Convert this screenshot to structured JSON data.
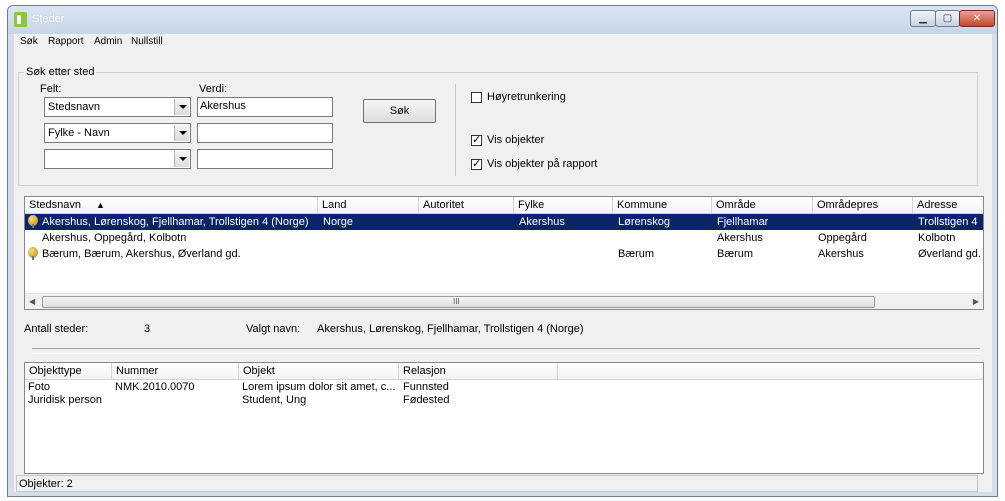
{
  "window": {
    "title": "Steder"
  },
  "menu": [
    "Søk",
    "Rapport",
    "Admin",
    "Nullstill"
  ],
  "search": {
    "legend": "Søk etter sted",
    "felt_label": "Felt:",
    "verdi_label": "Verdi:",
    "rows": [
      {
        "field": "Stedsnavn",
        "value": "Akershus"
      },
      {
        "field": "Fylke - Navn",
        "value": ""
      },
      {
        "field": "",
        "value": ""
      }
    ],
    "search_button": "Søk",
    "options": [
      {
        "label": "Høyretrunkering",
        "checked": false
      },
      {
        "label": "Vis objekter",
        "checked": true
      },
      {
        "label": "Vis objekter på rapport",
        "checked": true
      }
    ]
  },
  "places": {
    "columns": [
      "Stedsnavn",
      "Land",
      "Autoritet",
      "Fylke",
      "Kommune",
      "Område",
      "Områdepres",
      "Adresse"
    ],
    "sort_indicator": "▲",
    "rows": [
      {
        "icon": true,
        "selected": true,
        "cells": [
          "Akershus, Lørenskog, Fjellhamar, Trollstigen 4 (Norge)",
          "Norge",
          "",
          "Akershus",
          "Lørenskog",
          "Fjellhamar",
          "",
          "Trollstigen 4"
        ]
      },
      {
        "icon": false,
        "selected": false,
        "cells": [
          "Akershus, Oppegård, Kolbotn",
          "",
          "",
          "",
          "",
          "Akershus",
          "Oppegård",
          "Kolbotn"
        ]
      },
      {
        "icon": true,
        "selected": false,
        "cells": [
          "Bærum, Bærum, Akershus, Øverland gd.",
          "",
          "",
          "",
          "Bærum",
          "Bærum",
          "Akershus",
          "Øverland gd."
        ]
      }
    ],
    "scroll_grip": "III"
  },
  "summary": {
    "count_label": "Antall steder:",
    "count_value": "3",
    "chosen_label": "Valgt navn:",
    "chosen_value": "Akershus, Lørenskog, Fjellhamar, Trollstigen 4 (Norge)"
  },
  "objects": {
    "columns": [
      "Objekttype",
      "Nummer",
      "Objekt",
      "Relasjon"
    ],
    "rows": [
      [
        "Foto",
        "NMK.2010.0070",
        "Lorem ipsum dolor sit amet, c...",
        "Funnsted"
      ],
      [
        "Juridisk person",
        "",
        "Student, Ung",
        "Fødested"
      ]
    ]
  },
  "status": {
    "text": "Objekter: 2"
  }
}
